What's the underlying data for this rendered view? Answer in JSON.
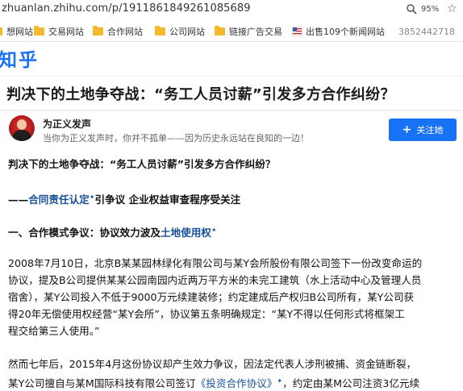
{
  "browser": {
    "url": "zhuanlan.zhihu.com/p/1911861849261085689",
    "zoom": "95%",
    "zoom_icon": "search-icon",
    "star_icon": "star-icon"
  },
  "bookmarks": {
    "items": [
      {
        "label": "想网站",
        "icon": "folder-icon"
      },
      {
        "label": "交易网站",
        "icon": "folder-icon"
      },
      {
        "label": "合作网站",
        "icon": "folder-icon"
      },
      {
        "label": "公司网站",
        "icon": "folder-icon"
      },
      {
        "label": "链接广告交易",
        "icon": "folder-icon"
      },
      {
        "label": "出售109个新闻网站",
        "icon": "flag-icon"
      }
    ],
    "phone": "3852442718"
  },
  "site": {
    "logo": "知乎",
    "brand_color": "#1772f6"
  },
  "article": {
    "title": "判决下的土地争夺战：“务工人员讨薪”引发多方合作纠纷？",
    "author": {
      "name": "为正义发声",
      "bio": "当你为正义发声时，你并不孤单——因为历史永远站在良知的一边！",
      "follow_label": "关注她"
    },
    "body": {
      "heading": "判决下的土地争夺战：“务工人员讨薪”引发多方合作纠纷？",
      "sub_prefix": "——",
      "sub_link": "合同责任认定",
      "sub_rest": "引争议 企业权益审查程序受关注",
      "section1_prefix": "一、合作模式争议：协议效力波及",
      "section1_link": "土地使用权",
      "para1_lines": [
        "2008年7月10日，北京B某某园林绿化有限公司与某Y会所股份有限公司签下一份改变命运的",
        "协议，提及B公司提供某某公园南园内近两万平方米的未完工建筑（水上活动中心及管理人员",
        "宿舍），某Y公司投入不低于9000万元续建装修；约定建成后产权归B公司所有，某Y公司获",
        "得20年无偿使用权经营“某Y会所”，协议第五条明确规定：“某Y不得以任何形式将框架工",
        "程交给第三人使用。”"
      ],
      "para2_line1": "然而七年后，2015年4月这份协议却产生效力争议，因法定代表人涉刑被捕、资金链断裂，",
      "para2_line2_prefix": "某Y公司擅自与某M国际科技有限公司签订",
      "para2_line2_link": "《投资合作协议》",
      "para2_line2_rest": "，约定由某M公司注资3亿元续"
    }
  }
}
